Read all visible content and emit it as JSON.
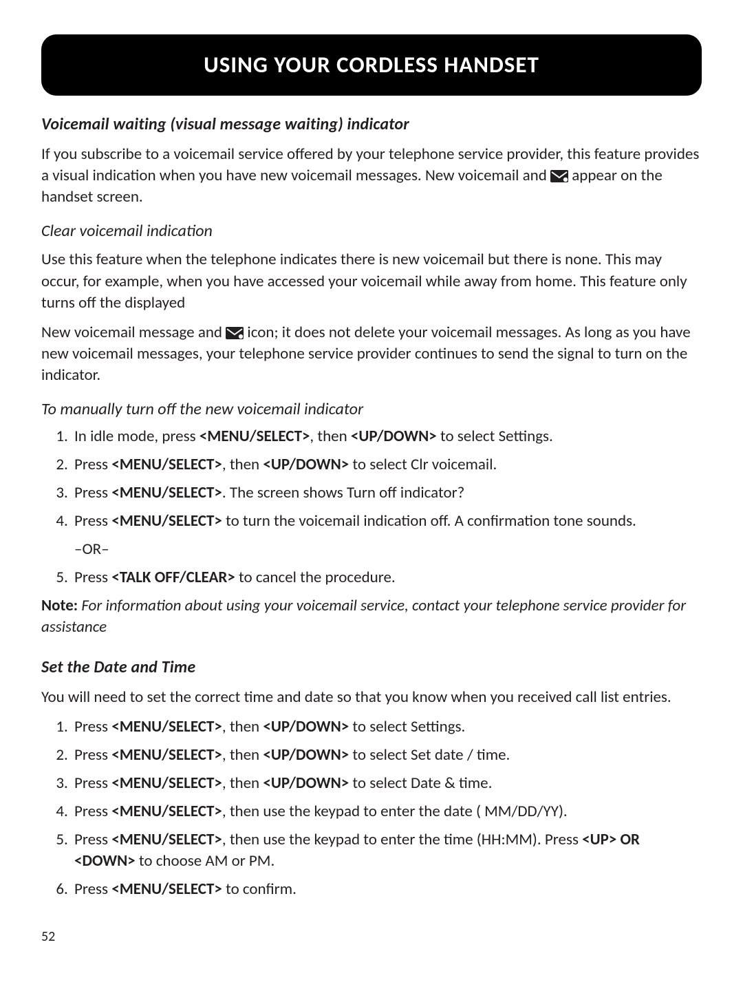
{
  "banner": "USING YOUR CORDLESS HANDSET",
  "section1": {
    "heading": "Voicemail waiting (visual message waiting) indicator",
    "p1_a": "If you subscribe to a voicemail service offered by your telephone service provider, this feature provides a visual indication when you have new voicemail messages. New voicemail and ",
    "p1_b": " appear on the handset screen."
  },
  "section2": {
    "heading": "Clear voicemail indication",
    "p1": "Use this feature when the telephone indicates there is new voicemail but there is none. This may occur, for example, when you have accessed your voicemail while away from home. This feature only turns off the displayed",
    "p2_a": "New voicemail message and ",
    "p2_b": " icon; it does not delete your voicemail messages. As long as you have new voicemail messages, your telephone service provider continues to send the signal to turn on the indicator."
  },
  "section3": {
    "heading": "To manually turn off the new voicemail indicator",
    "steps": {
      "s1_a": "In idle mode, press ",
      "s1_b": ", then ",
      "s1_c": " to select Settings.",
      "s2_a": "Press ",
      "s2_b": ", then ",
      "s2_c": " to select Clr voicemail.",
      "s3_a": "Press ",
      "s3_b": ".  The screen shows Turn off indicator?",
      "s4_a": "Press ",
      "s4_b": " to turn the voicemail indication off. A confirmation tone sounds.",
      "s4_or": "–OR–",
      "s5_a": "Press ",
      "s5_b": " to cancel the procedure."
    }
  },
  "buttons": {
    "menu": "<MENU/SELECT>",
    "updown": "<UP/DOWN>",
    "talkoff": "<TALK OFF/CLEAR>",
    "upOrDown": "<UP> OR <DOWN>"
  },
  "note": {
    "label": "Note:",
    "text": " For information about using your voicemail service, contact your telephone service provider for assistance"
  },
  "section4": {
    "heading": "Set the Date and Time",
    "intro": "You will need to set the correct time and date so that you know when you received call list entries.",
    "steps": {
      "d1_a": "Press ",
      "d1_b": ", then ",
      "d1_c": " to select Settings.",
      "d2_a": "Press ",
      "d2_b": ", then ",
      "d2_c": " to select Set date / time.",
      "d3_a": "Press ",
      "d3_b": ", then ",
      "d3_c": " to select Date & time.",
      "d4_a": "Press ",
      "d4_b": ", then use the keypad to enter the date ( MM/DD/YY).",
      "d5_a": "Press ",
      "d5_b": ", then use the keypad to enter the time (HH:MM). Press ",
      "d5_c": " to choose AM or PM.",
      "d6_a": "Press ",
      "d6_b": " to confirm."
    }
  },
  "pageNumber": "52"
}
